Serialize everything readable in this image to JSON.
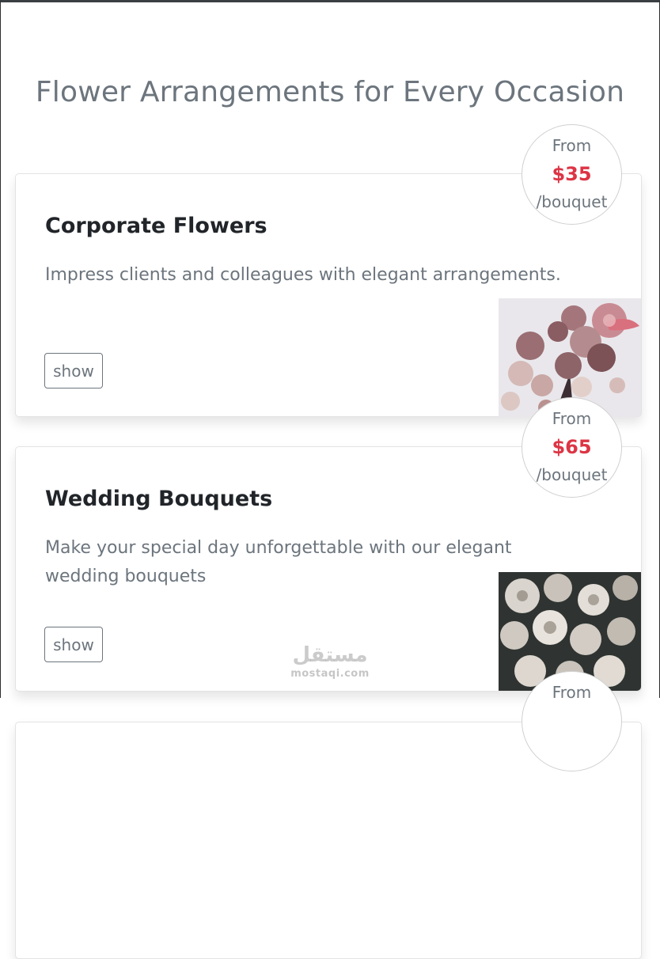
{
  "page": {
    "title": "Flower Arrangements for Every Occasion"
  },
  "cards": [
    {
      "title": "Corporate Flowers",
      "description": "Impress clients and colleagues with elegant arrangements.",
      "button_label": "show",
      "price": {
        "from_label": "From",
        "amount": "$35",
        "unit": "/bouquet"
      },
      "image": "pink-dried-flowers-bouquet"
    },
    {
      "title": "Wedding Bouquets",
      "description": "Make your special day unforgettable with our elegant wedding bouquets",
      "button_label": "show",
      "price": {
        "from_label": "From",
        "amount": "$65",
        "unit": "/bouquet"
      },
      "image": "white-roses-wedding-bouquet"
    },
    {
      "price": {
        "from_label": "From"
      }
    }
  ],
  "watermark": {
    "script_text": "مستقل",
    "latin_text": "mostaqi.com"
  },
  "colors": {
    "title_gray": "#6c757d",
    "price_red": "#dc3545",
    "heading_dark": "#212529"
  }
}
